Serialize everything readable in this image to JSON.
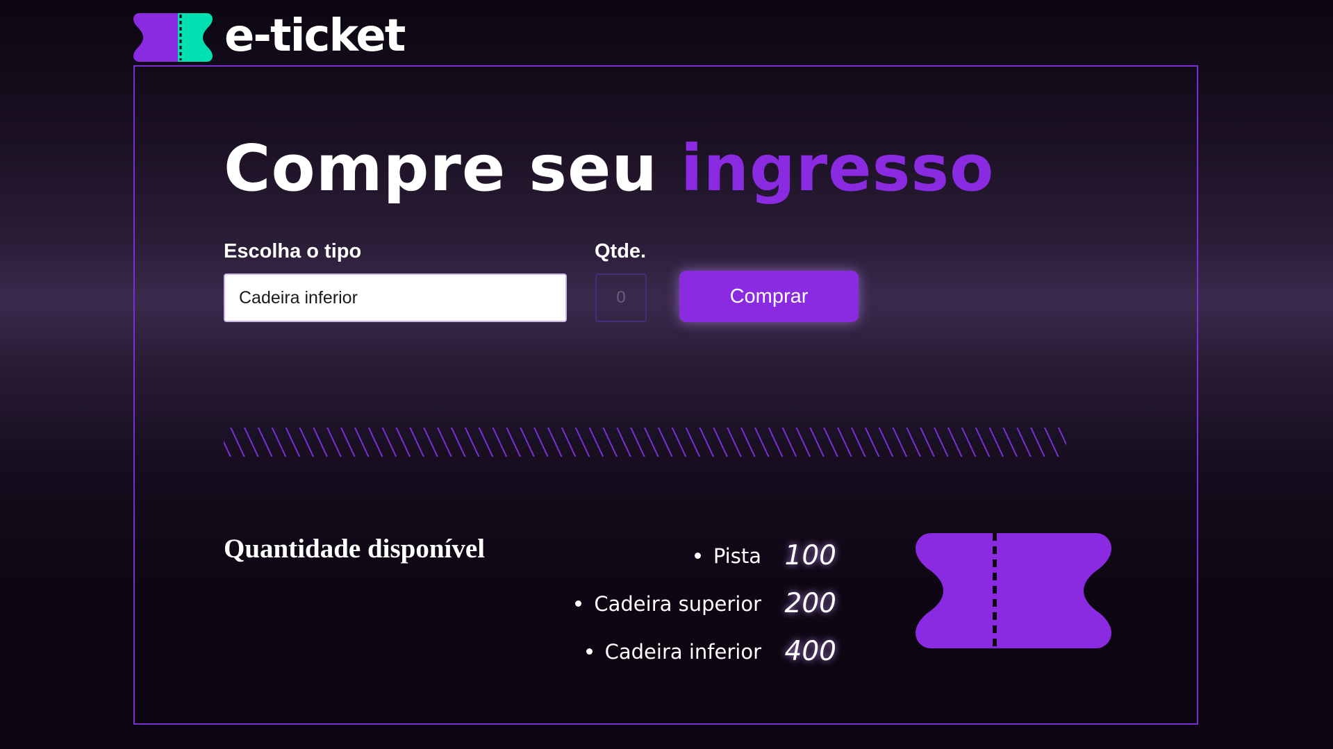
{
  "brand": {
    "name": "e-ticket",
    "logo_icon": "ticket-icon",
    "logo_colors": [
      "#8a2be2",
      "#00e0b0"
    ]
  },
  "colors": {
    "accent": "#8a2be2",
    "secondary": "#00e0b0",
    "frame_border": "#7b2ed6"
  },
  "form": {
    "title_main": "Compre seu ",
    "title_accent": "ingresso",
    "type_label": "Escolha o tipo",
    "type_value": "Cadeira inferior",
    "qty_label": "Qtde.",
    "qty_placeholder": "0",
    "buy_label": "Comprar"
  },
  "availability": {
    "heading": "Quantidade disponível",
    "items": [
      {
        "name": "Pista",
        "count": "100"
      },
      {
        "name": "Cadeira superior",
        "count": "200"
      },
      {
        "name": "Cadeira inferior",
        "count": "400"
      }
    ],
    "illustration_icon": "ticket-icon"
  }
}
